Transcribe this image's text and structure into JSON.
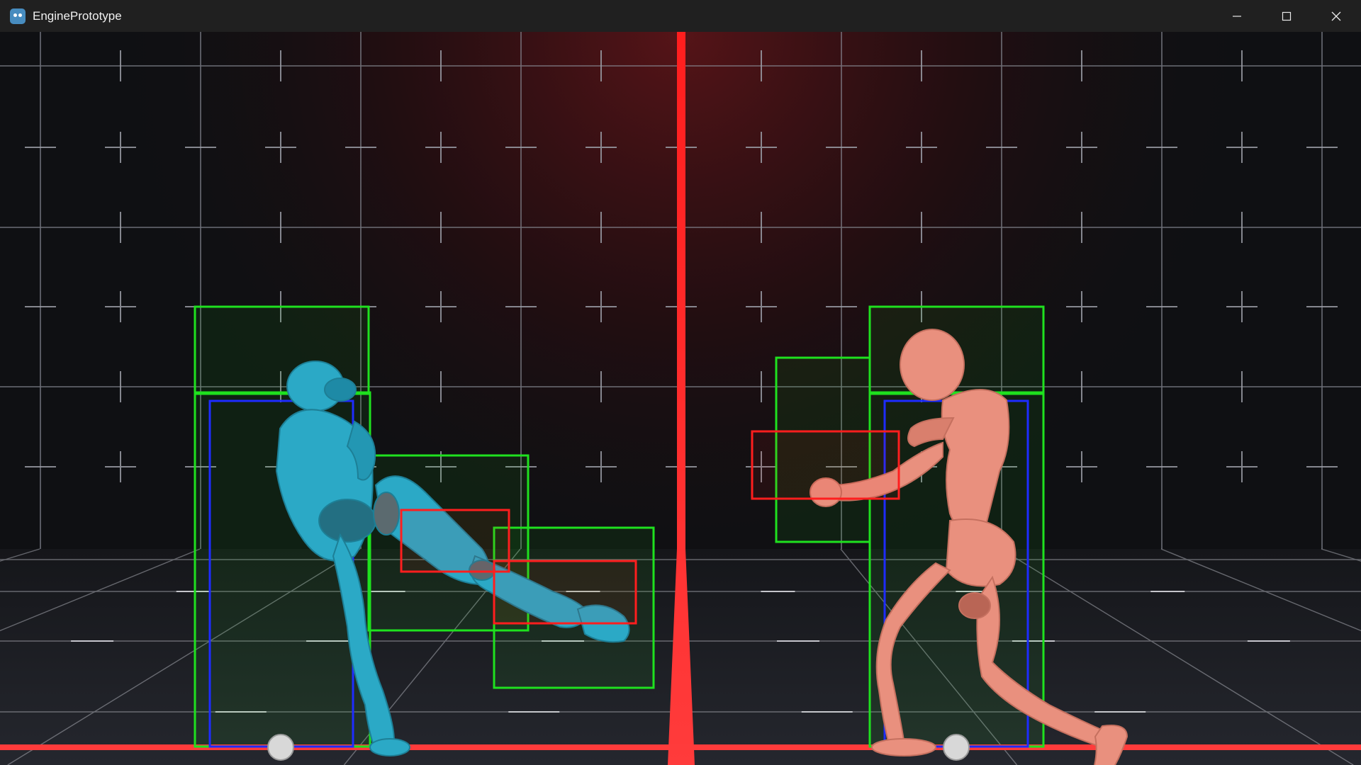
{
  "window": {
    "title": "EnginePrototype",
    "app_icon": "godot-icon",
    "controls": {
      "minimize_icon": "minimize-icon",
      "maximize_icon": "maximize-icon",
      "close_icon": "close-icon"
    }
  },
  "scene": {
    "background_color": "#0f1013",
    "wall_glow_color": "#5a1418",
    "grid_line_color": "#8a8d97",
    "floor_line_color": "#a6a8b0",
    "center_line_color": "#ff2a2a",
    "ground_line_color": "#ff3b3b",
    "hurtbox_color": "#1fe11f",
    "hitbox_color": "#ff1e1e",
    "pushbox_color": "#1e2cff",
    "player1": {
      "name": "cyan-fighter",
      "color": "#2ba9c6",
      "stance": "kick"
    },
    "player2": {
      "name": "pink-fighter",
      "color": "#e9907e",
      "stance": "punch"
    },
    "position_marker_color": "#d8d8d8"
  }
}
